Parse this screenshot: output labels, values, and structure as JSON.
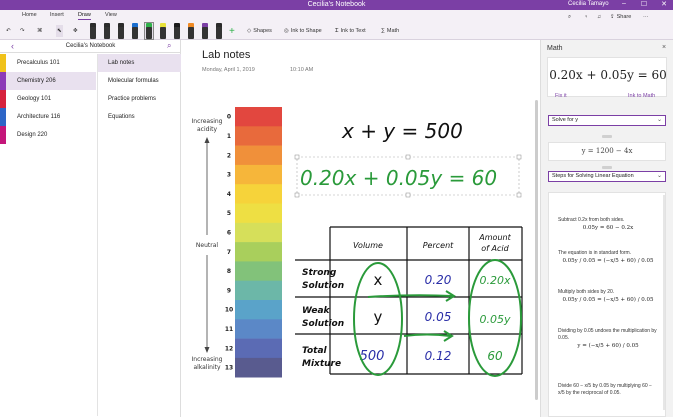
{
  "window": {
    "title": "Cecilia's Notebook",
    "user": "Cecilia Tamayo",
    "minimize": "–",
    "maximize": "☐",
    "close": "✕"
  },
  "ribbon": {
    "tabs": [
      "Home",
      "Insert",
      "Draw",
      "View"
    ],
    "active_tab": "Draw",
    "shapes_label": "Shapes",
    "ink_to_shape_label": "Ink to Shape",
    "ink_to_text_label": "Ink to Text",
    "math_label": "Math",
    "share_label": "Share",
    "pen_colors": [
      "#2b2b2b",
      "#2b2b2b",
      "#2b2b2b",
      "#1a6ecf",
      "#2fb24a",
      "#e8e23a",
      "#1a1a1a",
      "#f08a24",
      "#7b3fa5",
      "#2b2b2b"
    ],
    "selected_pen": 4
  },
  "nav": {
    "notebook_name": "Cecilia's Notebook",
    "sections": [
      {
        "label": "Precalculus 101",
        "color": "#f0c21a"
      },
      {
        "label": "Chemistry 206",
        "color": "#8c3bb7"
      },
      {
        "label": "Geology 101",
        "color": "#d6223d"
      },
      {
        "label": "Architecture 116",
        "color": "#2e66c7"
      },
      {
        "label": "Design 220",
        "color": "#c4167a"
      }
    ],
    "active_section": 1,
    "pages": [
      "Lab notes",
      "Molecular formulas",
      "Practice problems",
      "Equations"
    ],
    "active_page": 0
  },
  "page": {
    "title": "Lab notes",
    "date": "Monday, April 1, 2019",
    "time": "10:10 AM",
    "ph_scale": {
      "top_label": [
        "Increasing",
        "acidity"
      ],
      "middle_label": "Neutral",
      "bottom_label": [
        "Increasing",
        "alkalinity"
      ],
      "numbers": [
        "0",
        "1",
        "2",
        "3",
        "4",
        "5",
        "6",
        "7",
        "8",
        "9",
        "10",
        "11",
        "12",
        "13"
      ],
      "colors": [
        "#e2473f",
        "#e86a3c",
        "#f0903a",
        "#f6b63a",
        "#f6d33a",
        "#eedf43",
        "#d6df5a",
        "#a9cf5c",
        "#82c27a",
        "#6cb7a8",
        "#5aa3c9",
        "#5b88c7",
        "#5b6bb4",
        "#595b8f"
      ]
    },
    "ink": {
      "equation_one": "x + y = 500",
      "equation_two": "0.20x + 0.05y = 60",
      "table_headers": [
        "Volume",
        "Percent",
        "Amount",
        "of Acid"
      ],
      "row_labels": [
        [
          "Strong",
          "Solution"
        ],
        [
          "Weak",
          "Solution"
        ],
        [
          "Total",
          "Mixture"
        ]
      ],
      "cells": [
        [
          "x",
          "0.20",
          "0.20x"
        ],
        [
          "y",
          "0.05",
          "0.05y"
        ],
        [
          "500",
          "0.12",
          "60"
        ]
      ]
    }
  },
  "math": {
    "pane_title": "Math",
    "close": "×",
    "equation": "0.20x + 0.05y = 60",
    "fix_it": "Fix it",
    "ink_to_math": "Ink to Math",
    "action": "Solve for y",
    "solution": "y = 1200 − 4x",
    "steps_title": "Steps for Solving Linear Equation",
    "steps": [
      {
        "text": "Subtract 0.2x from both sides.",
        "eq": "0.05y = 60 − 0.2x"
      },
      {
        "text": "The equation is in standard form.",
        "eq": "0.05y / 0.05 = (−x/5 + 60) / 0.05"
      },
      {
        "text": "Multiply both sides by 20.",
        "eq": "0.05y / 0.05 = (−x/5 + 60) / 0.05"
      },
      {
        "text": "Dividing by 0.05 undoes the multiplication by 0.05.",
        "eq": "y = (−x/5 + 60) / 0.05"
      },
      {
        "text": "Divide 60 − x/5 by 0.05 by multiplying 60 − x/5 by the reciprocal of 0.05.",
        "eq": ""
      }
    ]
  }
}
